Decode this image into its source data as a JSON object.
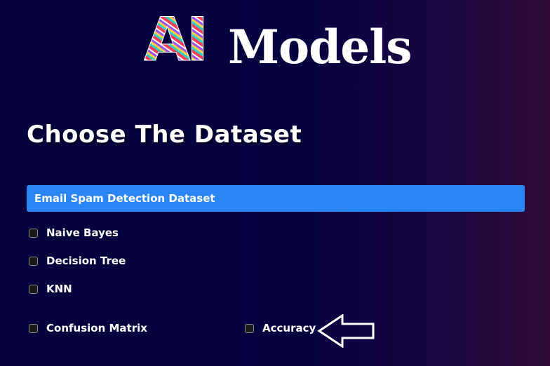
{
  "logo": {
    "ai_text": "AI",
    "models_text": "Models"
  },
  "heading": "Choose The Dataset",
  "dataset_select": {
    "selected": "Email Spam Detection Dataset"
  },
  "models": [
    {
      "label": "Naive Bayes",
      "checked": false
    },
    {
      "label": "Decision Tree",
      "checked": false
    },
    {
      "label": "KNN",
      "checked": false
    }
  ],
  "metrics": [
    {
      "label": "Confusion Matrix",
      "checked": false
    },
    {
      "label": "Accuracy",
      "checked": false
    }
  ],
  "colors": {
    "background_left": "#05023d",
    "background_right": "#300a38",
    "select_blue": "#2a86f5",
    "text": "#ffffff"
  },
  "icons": {
    "pointer_arrow": "arrow-left-outline-icon"
  }
}
